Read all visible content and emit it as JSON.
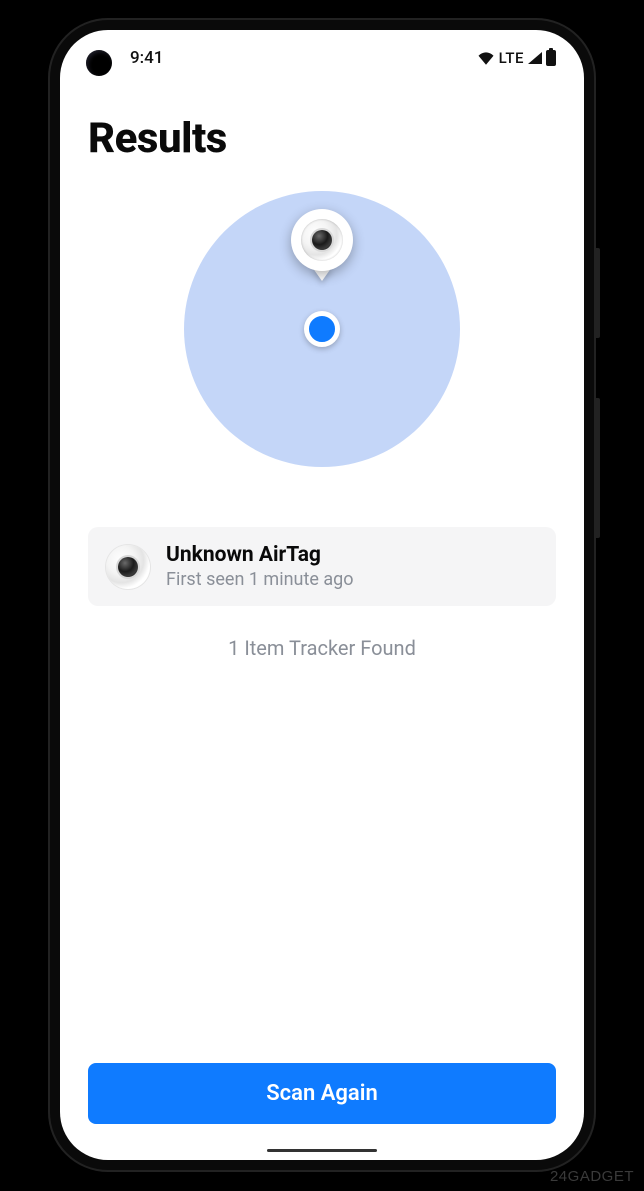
{
  "status_bar": {
    "time": "9:41",
    "network_label": "LTE"
  },
  "page": {
    "title": "Results",
    "summary": "1 Item Tracker Found"
  },
  "items": [
    {
      "name": "Unknown AirTag",
      "subtitle": "First seen 1 minute ago"
    }
  ],
  "actions": {
    "scan_again": "Scan Again"
  },
  "watermark": "24GADGET"
}
